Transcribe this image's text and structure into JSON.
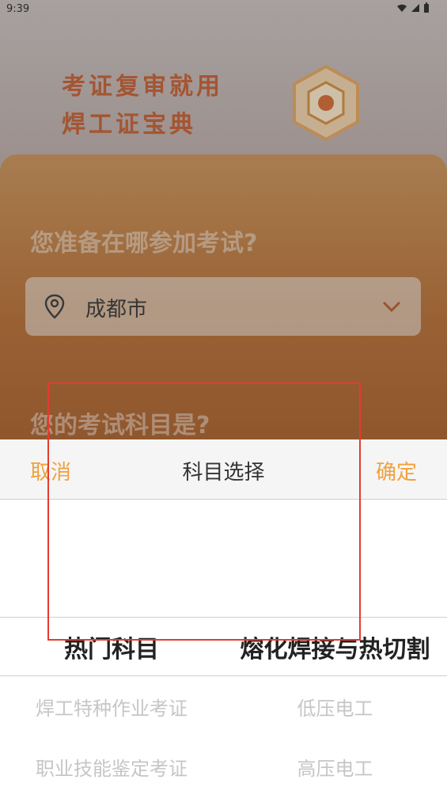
{
  "status_bar": {
    "time": "9:39"
  },
  "hero": {
    "title_line1": "考证复审就用",
    "title_line2": "焊工证宝典"
  },
  "form": {
    "question_location": "您准备在哪参加考试?",
    "city_value": "成都市",
    "question_subject": "您的考试科目是?"
  },
  "sheet": {
    "cancel_label": "取消",
    "title": "科目选择",
    "confirm_label": "确定",
    "left_column": {
      "selected": "热门科目",
      "items": [
        "焊工特种作业考证",
        "职业技能鉴定考证"
      ]
    },
    "right_column": {
      "selected": "熔化焊接与热切割",
      "items": [
        "低压电工",
        "高压电工"
      ]
    }
  },
  "colors": {
    "accent": "#f2a13a",
    "brand": "#c35a2b",
    "highlight_box": "#e53b2f"
  },
  "icons": [
    "wifi-icon",
    "signal-icon",
    "battery-icon",
    "location-pin-icon",
    "chevron-down-icon",
    "hexagon-badge-icon"
  ]
}
